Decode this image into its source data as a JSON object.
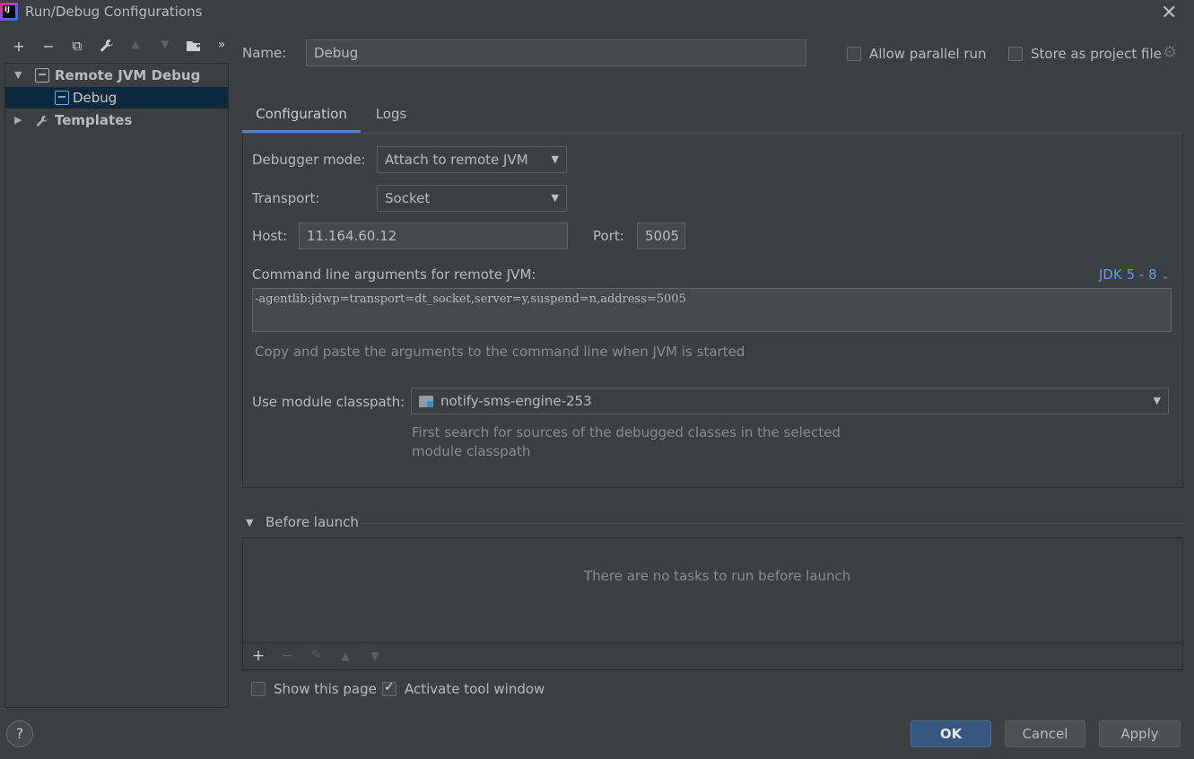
{
  "window": {
    "title": "Run/Debug Configurations"
  },
  "toolbar": {
    "add": "+",
    "remove": "−",
    "copy": "⧉",
    "wrench": "🔧",
    "up": "▲",
    "down": "▼",
    "folder": "📁",
    "more": "»"
  },
  "tree": {
    "group_label": "Remote JVM Debug",
    "child_label": "Debug",
    "templates_label": "Templates"
  },
  "header": {
    "name_label": "Name:",
    "name_value": "Debug",
    "allow_parallel_label": "Allow parallel run",
    "allow_parallel_checked": false,
    "store_project_label": "Store as project file",
    "store_project_checked": false
  },
  "tabs": [
    {
      "label": "Configuration",
      "active": true
    },
    {
      "label": "Logs",
      "active": false
    }
  ],
  "config": {
    "debugger_mode_label": "Debugger mode:",
    "debugger_mode_value": "Attach to remote JVM",
    "transport_label": "Transport:",
    "transport_value": "Socket",
    "host_label": "Host:",
    "host_value": "11.164.60.12",
    "port_label": "Port:",
    "port_value": "5005",
    "cmd_label": "Command line arguments for remote JVM:",
    "jdk_link": "JDK 5 - 8",
    "cmd_value": "-agentlib:jdwp=transport=dt_socket,server=y,suspend=n,address=5005",
    "cmd_hint": "Copy and paste the arguments to the command line when JVM is started",
    "module_label": "Use module classpath:",
    "module_value": "notify-sms-engine-253",
    "module_hint_line1": "First search for sources of the debugged classes in the selected",
    "module_hint_line2": "module classpath"
  },
  "before_launch": {
    "title": "Before launch",
    "empty_text": "There are no tasks to run before launch",
    "show_page_label": "Show this page",
    "show_page_checked": false,
    "activate_label": "Activate tool window",
    "activate_checked": true
  },
  "footer": {
    "help": "?",
    "ok": "OK",
    "cancel": "Cancel",
    "apply": "Apply"
  },
  "colors": {
    "background": "#3c3f41",
    "accent": "#4a88c7",
    "link": "#589df6",
    "selection": "#0d293e"
  }
}
